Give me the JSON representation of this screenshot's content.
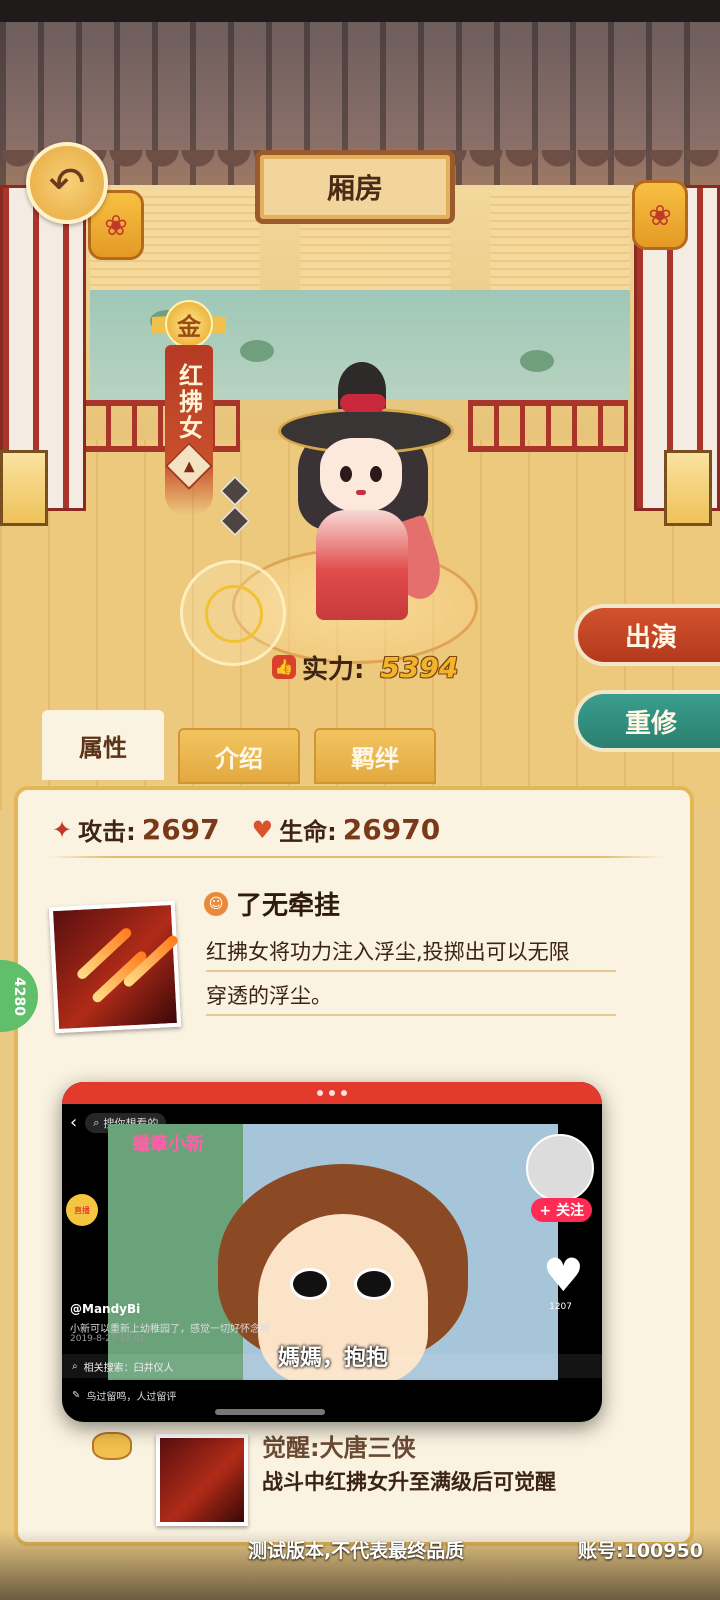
{
  "header": {
    "title": "厢房",
    "back_icon": "back-arrow-icon"
  },
  "hero": {
    "grade": "金",
    "name": "红拂女",
    "power_label": "实力:",
    "power_value": "5394"
  },
  "actions": {
    "perform_label": "出演",
    "retrain_label": "重修"
  },
  "tabs": [
    {
      "label": "属性",
      "active": true
    },
    {
      "label": "介绍",
      "active": false
    },
    {
      "label": "羁绊",
      "active": false
    }
  ],
  "stats": {
    "attack_label": "攻击:",
    "attack_value": "2697",
    "hp_label": "生命:",
    "hp_value": "26970"
  },
  "skill": {
    "name": "了无牵挂",
    "description_line1": "红拂女将功力注入浮尘,投掷出可以无限",
    "description_line2": "穿透的浮尘。"
  },
  "awaken": {
    "title": "觉醒:大唐三侠",
    "description": "战斗中红拂女升至满级后可觉醒"
  },
  "side_chip_text": "4280",
  "video_overlay": {
    "search_placeholder": "搜你想看的",
    "show_logo": "蠟筆小新",
    "follow_label": "+ 关注",
    "like_count": "1207",
    "username": "@MandyBi",
    "caption": "小新可以重新上幼稚园了，感觉一切好怀念啊",
    "date": "2019-8-27 19:01",
    "subtitle": "媽媽，抱抱",
    "related_search": "相关搜索：臼井仪人",
    "comment_prompt": "鸟过留鸣，人过留评",
    "live_badge": "直播"
  },
  "footer": {
    "disclaimer": "测试版本,不代表最终品质",
    "account": "账号:100950"
  },
  "colors": {
    "accent_red": "#b3391d",
    "accent_teal": "#2a7f70",
    "gold": "#f4b42a",
    "panel_bg": "#fbf3e1"
  }
}
